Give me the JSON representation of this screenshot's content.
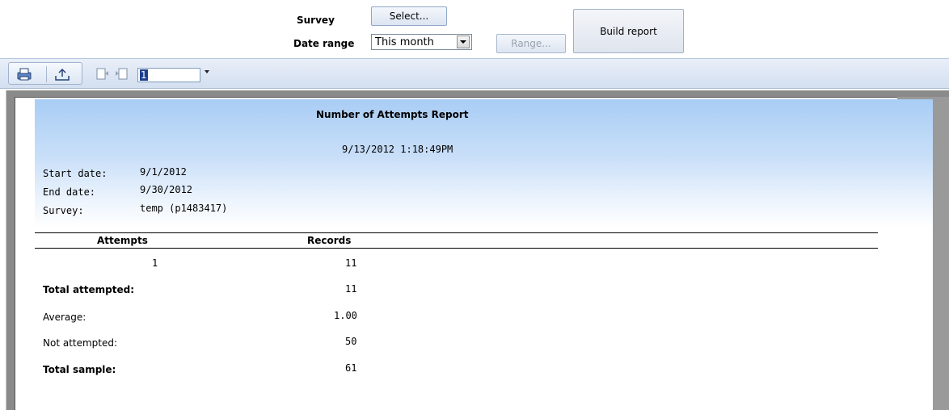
{
  "controls": {
    "survey_label": "Survey",
    "survey_button": "Select...",
    "date_range_label": "Date range",
    "date_range_value": "This month",
    "range_button": "Range...",
    "build_button": "Build report"
  },
  "toolbar": {
    "page_number": "1"
  },
  "report": {
    "title": "Number of Attempts Report",
    "datetime": "9/13/2012  1:18:49PM",
    "meta": [
      {
        "label": "Start date:",
        "value": "9/1/2012"
      },
      {
        "label": "End date:",
        "value": "9/30/2012"
      },
      {
        "label": "Survey:",
        "value": "temp (p1483417)"
      }
    ],
    "columns": {
      "attempts": "Attempts",
      "records": "Records"
    },
    "rows": [
      {
        "attempts": "1",
        "records": "11"
      }
    ],
    "summary": [
      {
        "label": "Total attempted:",
        "value": "11",
        "bold": true
      },
      {
        "label": "Average:",
        "value": "1.00",
        "bold": false
      },
      {
        "label": "Not attempted:",
        "value": "50",
        "bold": false
      },
      {
        "label": "Total sample:",
        "value": "61",
        "bold": true
      }
    ]
  },
  "colors": {
    "header_gradient_top": "#a9cdf5",
    "toolbar": "#dce6f3",
    "frame": "#8a8a8a"
  }
}
